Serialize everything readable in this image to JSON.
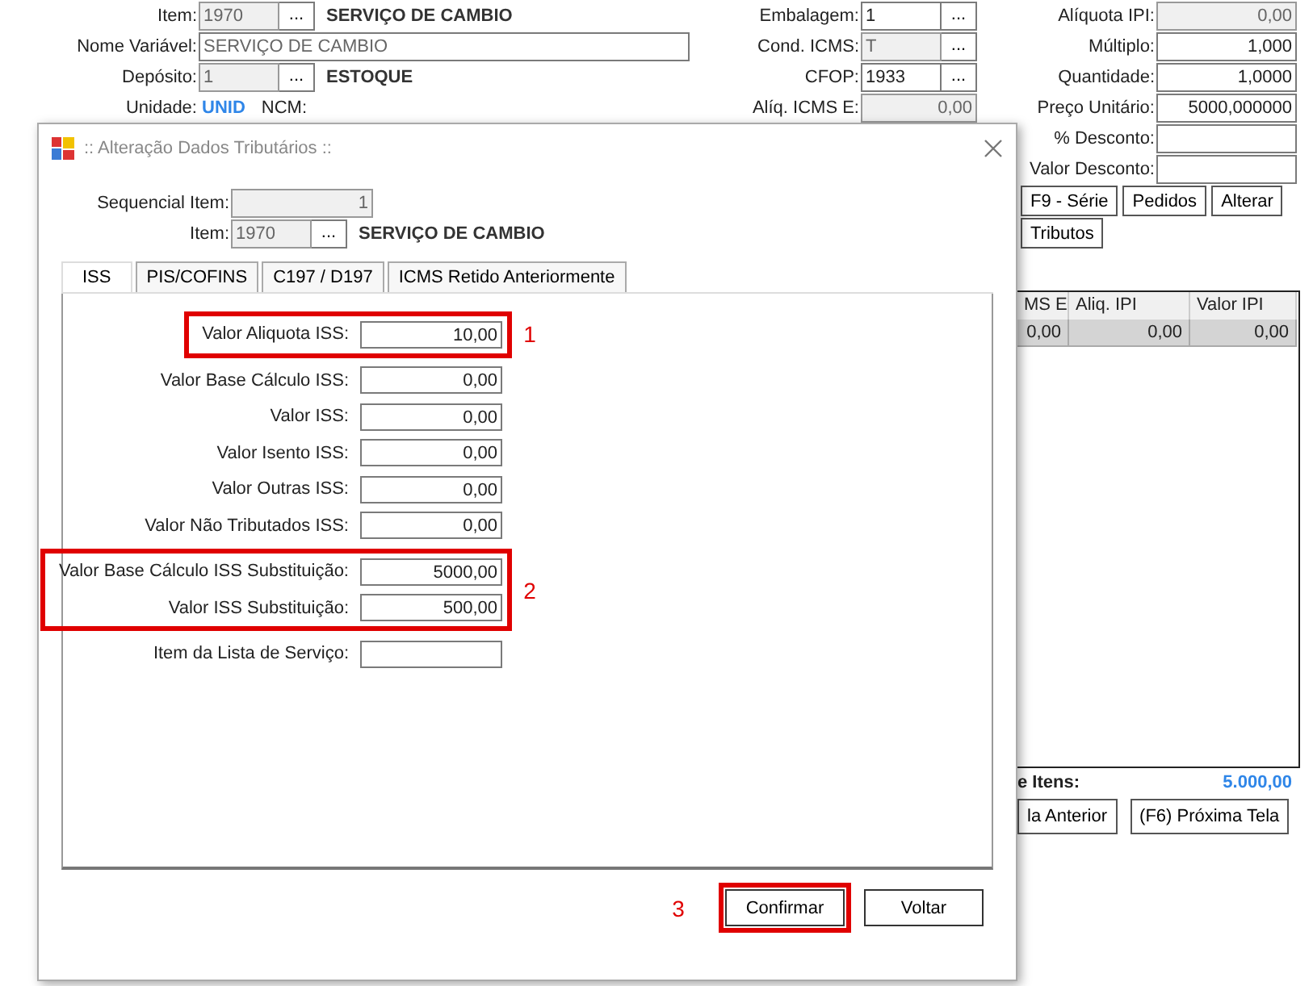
{
  "main": {
    "col1": [
      {
        "kind": "lookup",
        "label": "Item:",
        "value": "1970",
        "disabled": true,
        "button": "...",
        "caption": "SERVIÇO DE CAMBIO"
      },
      {
        "kind": "wide",
        "label": "Nome Variável:",
        "value": "SERVIÇO DE CAMBIO",
        "disabled": false
      },
      {
        "kind": "lookup",
        "label": "Depósito:",
        "value": "1",
        "disabled": true,
        "button": "...",
        "caption": "ESTOQUE"
      },
      {
        "kind": "info",
        "label": "Unidade:",
        "value": "UNID",
        "extra": "NCM:"
      }
    ],
    "col2": [
      {
        "kind": "lookup",
        "label": "Embalagem:",
        "value": "1",
        "disabled": false,
        "button": "..."
      },
      {
        "kind": "lookup",
        "label": "Cond. ICMS:",
        "value": "T",
        "disabled": true,
        "button": "..."
      },
      {
        "kind": "lookup",
        "label": "CFOP:",
        "value": "1933",
        "disabled": false,
        "button": "..."
      },
      {
        "kind": "number",
        "label": "Alíq. ICMS E:",
        "value": "0,00",
        "disabled": true
      }
    ],
    "col3": [
      {
        "kind": "number",
        "label": "Alíquota IPI:",
        "value": "0,00",
        "disabled": true
      },
      {
        "kind": "number",
        "label": "Múltiplo:",
        "value": "1,000",
        "disabled": false
      },
      {
        "kind": "number",
        "label": "Quantidade:",
        "value": "1,0000",
        "disabled": false
      },
      {
        "kind": "number",
        "label": "Preço Unitário:",
        "value": "5000,000000",
        "disabled": false
      },
      {
        "kind": "number",
        "label": "% Desconto:",
        "disabled": false
      },
      {
        "kind": "number",
        "label": "Valor Desconto:",
        "disabled": false
      }
    ],
    "button_rows": [
      {
        "buttons": [
          "F9 - Série",
          "Pedidos",
          "Alterar"
        ]
      },
      {
        "buttons": [
          "Tributos"
        ]
      }
    ],
    "table": {
      "columns": [
        "MS E",
        "Aliq. IPI",
        "Valor IPI"
      ],
      "rows": [
        {
          "selected": true,
          "cells": [
            "0,00",
            "0,00",
            "0,00"
          ]
        }
      ]
    },
    "totals": {
      "label": "e Itens:",
      "value": "5.000,00"
    },
    "nav_buttons": [
      "la Anterior",
      "(F6) Próxima Tela"
    ]
  },
  "dialog": {
    "title": ":: Alteração Dados Tributários ::",
    "fields": [
      {
        "kind": "number",
        "label": "Sequencial Item:",
        "value": "1",
        "disabled": true
      },
      {
        "kind": "lookup",
        "label": "Item:",
        "value": "1970",
        "disabled": true,
        "button": "...",
        "caption": "SERVIÇO DE CAMBIO"
      }
    ],
    "tabs": [
      {
        "label": "ISS",
        "selected": true
      },
      {
        "label": "PIS/COFINS",
        "selected": false
      },
      {
        "label": "C197 / D197",
        "selected": false
      },
      {
        "label": "ICMS Retido Anteriormente",
        "selected": false
      }
    ],
    "groups": [
      {
        "callout": "1",
        "fields": [
          {
            "label": "Valor Aliquota ISS:",
            "value": "10,00"
          }
        ]
      },
      {
        "fields": [
          {
            "label": "Valor Base Cálculo ISS:",
            "value": "0,00"
          },
          {
            "label": "Valor ISS:",
            "value": "0,00"
          },
          {
            "label": "Valor Isento ISS:",
            "value": "0,00"
          },
          {
            "label": "Valor Outras ISS:",
            "value": "0,00"
          },
          {
            "label": "Valor Não Tributados ISS:",
            "value": "0,00"
          }
        ]
      },
      {
        "callout": "2",
        "fields": [
          {
            "label": "Valor Base Cálculo ISS Substituição:",
            "value": "5000,00"
          },
          {
            "label": "Valor ISS Substituição:",
            "value": "500,00"
          }
        ]
      },
      {
        "fields": [
          {
            "label": "Item da Lista de Serviço:"
          }
        ]
      }
    ],
    "buttons": [
      {
        "label": "Confirmar",
        "callout": "3"
      },
      {
        "label": "Voltar"
      }
    ]
  }
}
